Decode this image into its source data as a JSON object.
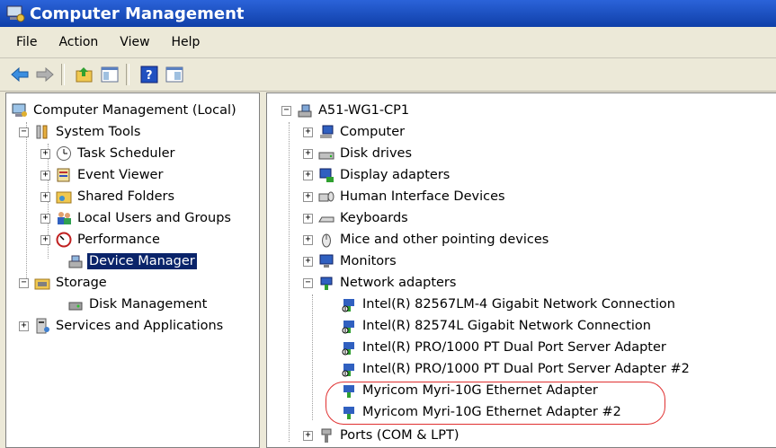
{
  "window": {
    "title": "Computer Management"
  },
  "menu": [
    "File",
    "Action",
    "View",
    "Help"
  ],
  "left_tree": {
    "root": "Computer Management (Local)",
    "system_tools": "System Tools",
    "task_scheduler": "Task Scheduler",
    "event_viewer": "Event Viewer",
    "shared_folders": "Shared Folders",
    "local_users": "Local Users and Groups",
    "performance": "Performance",
    "device_manager": "Device Manager",
    "storage": "Storage",
    "disk_management": "Disk Management",
    "services": "Services and Applications"
  },
  "right_tree": {
    "root": "A51-WG1-CP1",
    "items": [
      "Computer",
      "Disk drives",
      "Display adapters",
      "Human Interface Devices",
      "Keyboards",
      "Mice and other pointing devices",
      "Monitors",
      "Network adapters"
    ],
    "adapters": [
      "Intel(R) 82567LM-4 Gigabit Network Connection",
      "Intel(R) 82574L Gigabit Network Connection",
      "Intel(R) PRO/1000 PT Dual Port Server Adapter",
      "Intel(R) PRO/1000 PT Dual Port Server Adapter #2",
      "Myricom Myri-10G Ethernet Adapter",
      "Myricom Myri-10G Ethernet Adapter #2"
    ],
    "ports": "Ports (COM & LPT)"
  },
  "colors": {
    "highlight": "#e03030",
    "selection": "#0a246a"
  }
}
